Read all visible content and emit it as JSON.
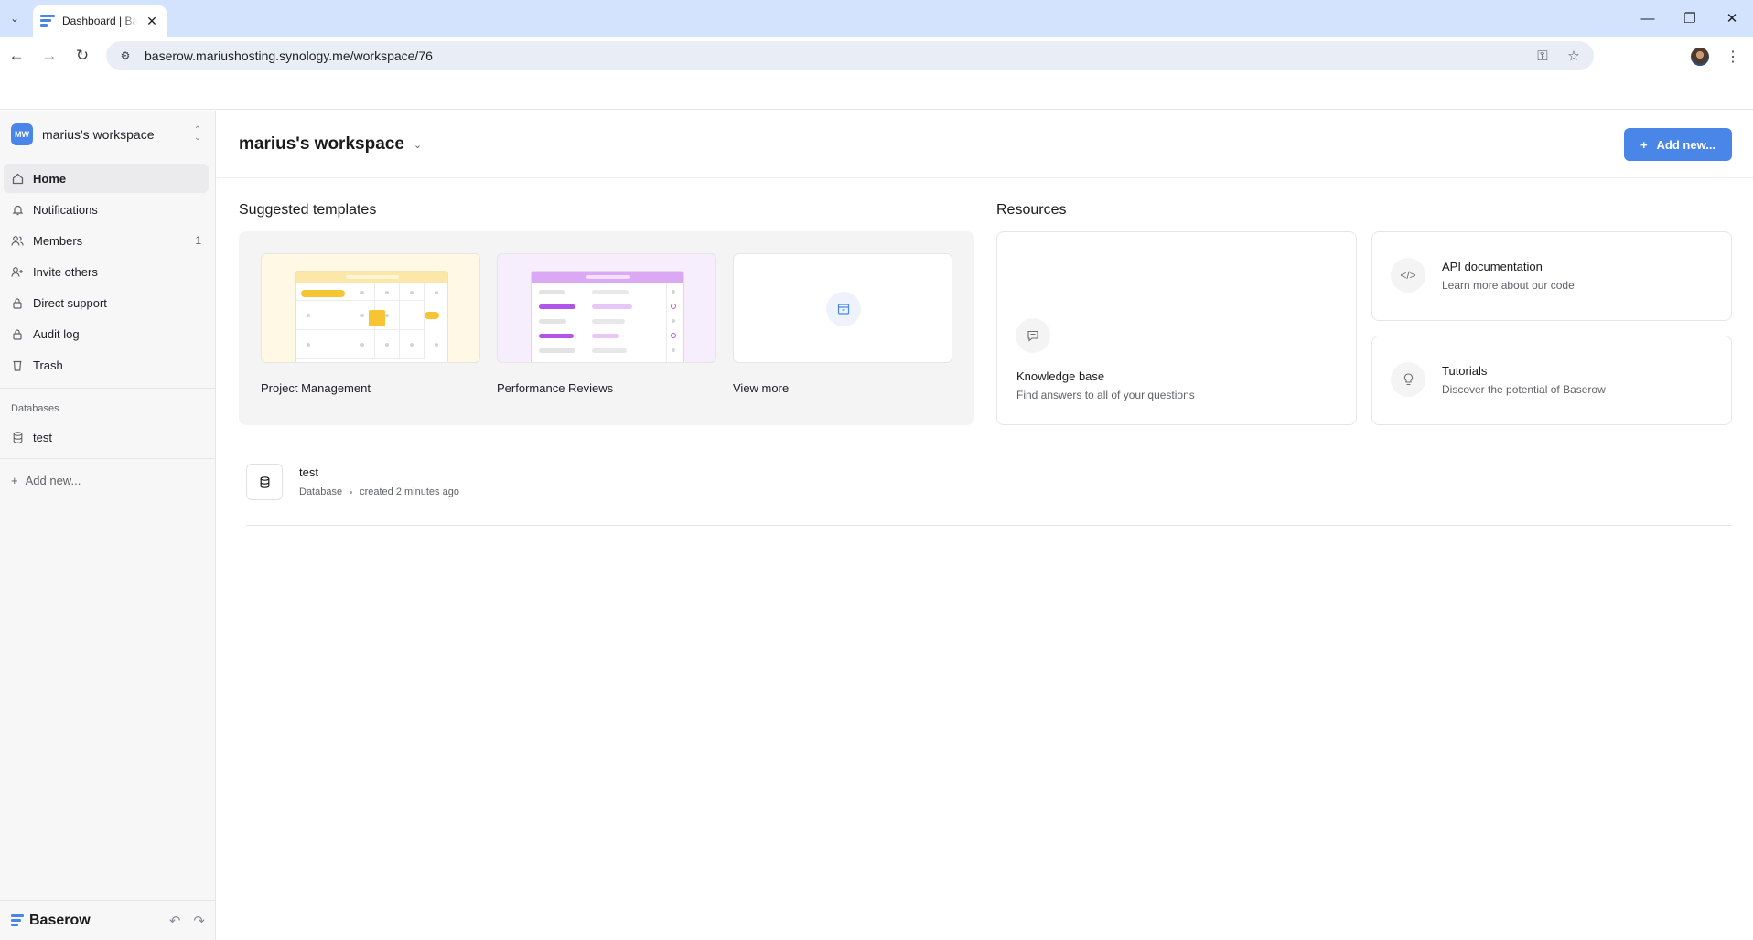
{
  "browser": {
    "tab_title": "Dashboard | Baserow",
    "url": "baserow.mariushosting.synology.me/workspace/76"
  },
  "sidebar": {
    "workspace_badge": "MW",
    "workspace_name": "marius's workspace",
    "nav": [
      {
        "label": "Home",
        "icon": "home-icon",
        "active": true
      },
      {
        "label": "Notifications",
        "icon": "bell-icon"
      },
      {
        "label": "Members",
        "icon": "users-icon",
        "count": "1"
      },
      {
        "label": "Invite others",
        "icon": "user-plus-icon"
      },
      {
        "label": "Direct support",
        "icon": "lock-icon"
      },
      {
        "label": "Audit log",
        "icon": "lock-icon"
      },
      {
        "label": "Trash",
        "icon": "trash-icon"
      }
    ],
    "databases_label": "Databases",
    "databases": [
      {
        "label": "test",
        "icon": "database-icon"
      }
    ],
    "add_new": "Add new...",
    "brand": "Baserow"
  },
  "header": {
    "title": "marius's workspace",
    "add_button": "Add new..."
  },
  "templates": {
    "title": "Suggested templates",
    "items": [
      {
        "name": "Project Management"
      },
      {
        "name": "Performance Reviews"
      },
      {
        "name": "View more"
      }
    ]
  },
  "resources": {
    "title": "Resources",
    "items": [
      {
        "title": "Knowledge base",
        "desc": "Find answers to all of your questions",
        "icon": "chat-icon"
      },
      {
        "title": "API documentation",
        "desc": "Learn more about our code",
        "icon": "code-icon"
      },
      {
        "title": "Tutorials",
        "desc": "Discover the potential of Baserow",
        "icon": "lightbulb-icon"
      }
    ]
  },
  "applications": [
    {
      "name": "test",
      "type": "Database",
      "created": "created 2 minutes ago"
    }
  ],
  "colors": {
    "accent": "#4a86e8",
    "project_yellow": "#f7c534",
    "reviews_purple": "#b154e8"
  }
}
